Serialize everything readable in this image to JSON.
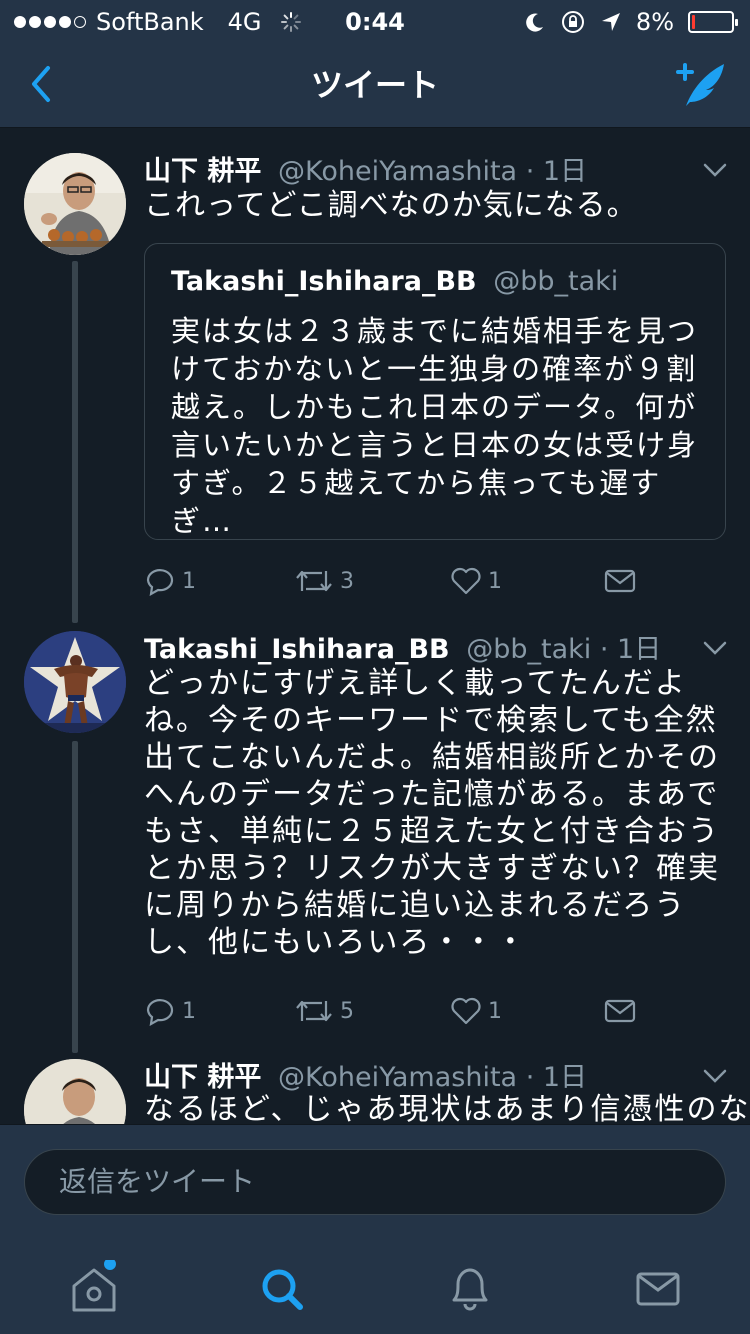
{
  "status": {
    "carrier": "SoftBank",
    "network": "4G",
    "time": "0:44",
    "battery": "8%",
    "battery_level": 0.08,
    "battery_color": "#ff3b30"
  },
  "nav": {
    "title": "ツイート",
    "back_icon": "chevron-left-icon",
    "compose_icon": "compose-tweet-icon",
    "accent": "#1da1f2"
  },
  "tweets": [
    {
      "name": "山下 耕平",
      "handle": "@KoheiYamashita",
      "time": "1日",
      "text": "これってどこ調べなのか気になる。",
      "quote": {
        "name": "Takashi_Ishihara_BB",
        "handle": "@bb_taki",
        "text": "実は女は２３歳までに結婚相手を見つけておかないと一生独身の確率が９割越え。しかもこれ日本のデータ。何が言いたいかと言うと日本の女は受け身すぎ。２５越えてから焦っても遅すぎ…"
      },
      "replies": "1",
      "retweets": "3",
      "likes": "1"
    },
    {
      "name": "Takashi_Ishihara_BB",
      "handle": "@bb_taki",
      "time": "1日",
      "text": "どっかにすげえ詳しく載ってたんだよね。今そのキーワードで検索しても全然出てこないんだよ。結婚相談所とかそのへんのデータだった記憶がある。まあでもさ、単純に２５超えた女と付き合おうとか思う？リスクが大きすぎない？確実に周りから結婚に追い込まれるだろうし、他にもいろいろ・・・",
      "replies": "1",
      "retweets": "5",
      "likes": "1"
    },
    {
      "name": "山下 耕平",
      "handle": "@KoheiYamashita",
      "time": "1日",
      "text": "なるほど、じゃあ現状はあまり信憑性のな"
    }
  ],
  "reply": {
    "placeholder": "返信をツイート"
  },
  "tabs": [
    "home-icon",
    "search-icon",
    "notifications-icon",
    "messages-icon"
  ]
}
